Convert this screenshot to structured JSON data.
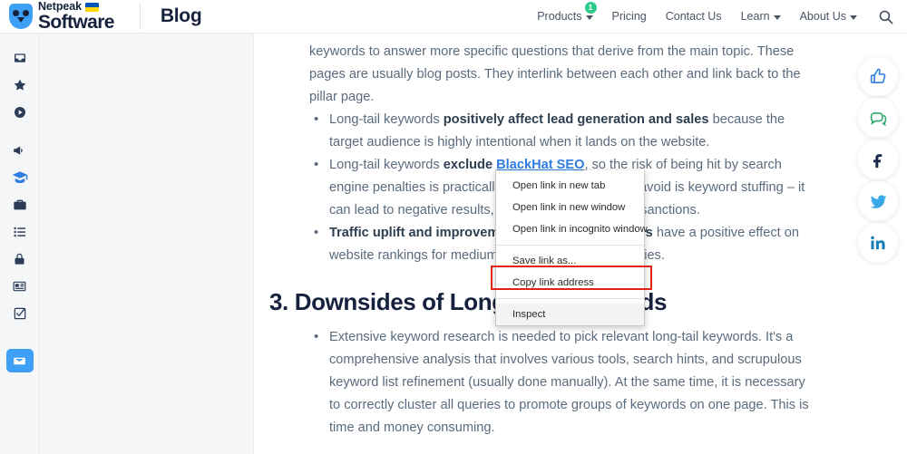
{
  "header": {
    "brand_netpeak": "Netpeak",
    "brand_software": "Software",
    "brand_flag": "ukraine-flag",
    "divider": "header-divider",
    "blog_title": "Blog",
    "nav": [
      {
        "label": "Products",
        "caret": true,
        "badge": "1"
      },
      {
        "label": "Pricing",
        "caret": false,
        "badge": ""
      },
      {
        "label": "Contact Us",
        "caret": false,
        "badge": ""
      },
      {
        "label": "Learn",
        "caret": true,
        "badge": ""
      },
      {
        "label": "About Us",
        "caret": true,
        "badge": ""
      }
    ],
    "search_icon": "search-icon"
  },
  "sidebar": {
    "items": [
      {
        "icon": "inbox-icon",
        "name": "sidebar-item-inbox",
        "state": "normal"
      },
      {
        "icon": "star-icon",
        "name": "sidebar-item-favorites",
        "state": "normal"
      },
      {
        "icon": "play-circle-icon",
        "name": "sidebar-item-media",
        "state": "normal"
      },
      {
        "icon": "megaphone-icon",
        "name": "sidebar-item-announcements",
        "state": "normal"
      },
      {
        "icon": "graduation-cap-icon",
        "name": "sidebar-item-learn",
        "state": "accent"
      },
      {
        "icon": "briefcase-icon",
        "name": "sidebar-item-business",
        "state": "normal"
      },
      {
        "icon": "list-icon",
        "name": "sidebar-item-list",
        "state": "normal"
      },
      {
        "icon": "lock-icon",
        "name": "sidebar-item-security",
        "state": "normal"
      },
      {
        "icon": "newspaper-icon",
        "name": "sidebar-item-news",
        "state": "normal"
      },
      {
        "icon": "checklist-icon",
        "name": "sidebar-item-tasks",
        "state": "normal"
      },
      {
        "icon": "envelope-icon",
        "name": "sidebar-item-mail",
        "state": "active"
      }
    ]
  },
  "social": {
    "buttons": [
      {
        "icon": "thumbs-up-icon",
        "name": "social-like-button",
        "color": "#2f7de1"
      },
      {
        "icon": "comment-icon",
        "name": "social-comments-button",
        "color": "#2fa86a"
      },
      {
        "icon": "facebook-icon",
        "name": "social-facebook-button",
        "color": "#1b2a4b"
      },
      {
        "icon": "twitter-icon",
        "name": "social-twitter-button",
        "color": "#3aa9ea"
      },
      {
        "icon": "linkedin-icon",
        "name": "social-linkedin-button",
        "color": "#1a7bb9"
      }
    ]
  },
  "article": {
    "para_top": "keywords to answer more specific questions that derive from the main topic. These pages are usually blog posts. They interlink between each other and link back to the pillar page.",
    "bullet1_pre": "Long-tail keywords ",
    "bullet1_bold": "positively affect lead generation and sales",
    "bullet1_post": " because the target audience is highly intentional when it lands on the website.",
    "bullet2_pre": "Long-tail keywords ",
    "bullet2_bold": "exclude ",
    "bullet2_link": "BlackHat SEO",
    "bullet2_post": ", so the risk of being hit by search engine penalties is practically zero. The only thing to avoid is keyword stuffing – it can lead to negative results, including search engine sanctions.",
    "bullet3_bold": "Traffic uplift and improvement of behavioral factors",
    "bullet3_post": " have a positive effect on website rankings for medium and high frequency queries.",
    "heading": "3. Downsides of Long-Tail Keywords",
    "bullet4": "Extensive keyword research is needed to pick relevant long-tail keywords. It's a comprehensive analysis that involves various tools, search hints, and scrupulous keyword list refinement (usually done manually). At the same time, it is necessary to correctly cluster all queries to promote groups of keywords on one page. This is time and money consuming."
  },
  "context_menu": {
    "items": [
      "Open link in new tab",
      "Open link in new window",
      "Open link in incognito window"
    ],
    "items2": [
      "Save link as...",
      "Copy link address"
    ],
    "inspect": "Inspect",
    "highlight_color": "#e32219"
  }
}
